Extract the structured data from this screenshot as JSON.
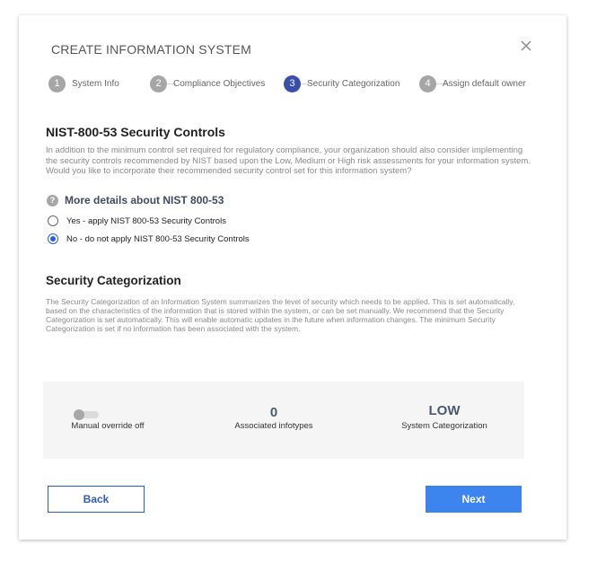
{
  "dialog": {
    "title": "CREATE INFORMATION SYSTEM"
  },
  "steps": [
    {
      "number": "1",
      "label": "System Info",
      "active": false
    },
    {
      "number": "2",
      "label": "Compliance Objectives",
      "active": false
    },
    {
      "number": "3",
      "label": "Security Categorization",
      "active": true
    },
    {
      "number": "4",
      "label": "Assign default owner",
      "active": false
    }
  ],
  "nist": {
    "heading": "NIST-800-53 Security Controls",
    "description": "In addition to the minimum control set required for regulatory compliance, your organization should also consider implementing the security controls recommended by NIST based upon the Low, Medium or High risk assessments for your information system.  Would you like to incorporate their recommended security control set for this information system?",
    "more_details_label": "More details about NIST 800-53",
    "more_details_icon": "?",
    "options": [
      {
        "label": "Yes - apply NIST 800-53 Security Controls",
        "checked": false
      },
      {
        "label": "No - do not apply NIST 800-53 Security Controls",
        "checked": true
      }
    ]
  },
  "categorization": {
    "heading": "Security Categorization",
    "description": "The Security Categorization of an Information System summarizes the level of security which needs to be applied. This is set automatically, based on the characteristics of the information that is stored within the system, or can be set manually. We recommend that the Security Categorization is set automatically. This will enable automatic updates in the future when information changes. The minimum Security Categorization is set if no information has been associated with the system.",
    "manual_override_label": "Manual override off",
    "manual_override_on": false,
    "infotypes_count": "0",
    "infotypes_label": "Associated infotypes",
    "level_value": "LOW",
    "level_label": "System Categorization"
  },
  "buttons": {
    "back": "Back",
    "next": "Next"
  },
  "colors": {
    "active_step": "#3a4fa8",
    "inactive_step": "#a6a6a6",
    "primary": "#3d84ee",
    "outline": "#2e5db8",
    "radio_checked": "#2b5fd9"
  },
  "icons": {
    "close": "close-icon",
    "help": "question-circle-icon",
    "toggle": "toggle-switch"
  }
}
